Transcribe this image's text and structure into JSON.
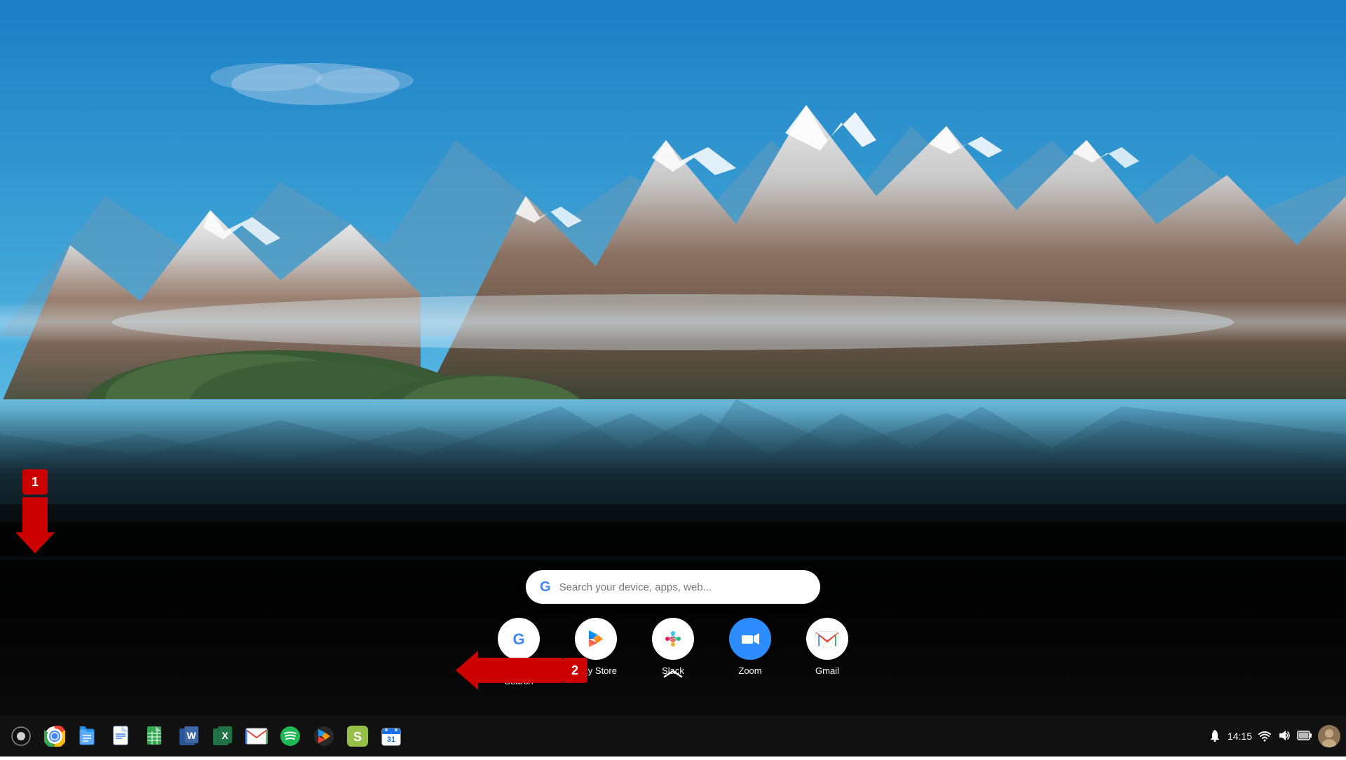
{
  "wallpaper": {
    "description": "Mountain lake landscape with snow-capped peaks"
  },
  "search": {
    "placeholder": "Search your device, apps, web...",
    "g_logo": "G"
  },
  "launcher": {
    "apps": [
      {
        "id": "google-search",
        "label": "Google Search",
        "type": "google"
      },
      {
        "id": "play-store",
        "label": "Play Store",
        "type": "playstore"
      },
      {
        "id": "slack",
        "label": "Slack",
        "type": "slack"
      },
      {
        "id": "zoom",
        "label": "Zoom",
        "type": "zoom"
      },
      {
        "id": "gmail",
        "label": "Gmail",
        "type": "gmail"
      }
    ],
    "chevron_up": "^"
  },
  "taskbar": {
    "icons": [
      {
        "id": "search",
        "label": "Search",
        "symbol": "○"
      },
      {
        "id": "chrome",
        "label": "Chrome",
        "symbol": "⊕"
      },
      {
        "id": "files",
        "label": "Files",
        "symbol": "📁"
      },
      {
        "id": "docs",
        "label": "Google Docs",
        "symbol": "📄"
      },
      {
        "id": "sheets",
        "label": "Google Sheets",
        "symbol": "📊"
      },
      {
        "id": "word",
        "label": "Microsoft Word",
        "symbol": "W"
      },
      {
        "id": "excel",
        "label": "Microsoft Excel",
        "symbol": "X"
      },
      {
        "id": "gmail",
        "label": "Gmail",
        "symbol": "M"
      },
      {
        "id": "spotify",
        "label": "Spotify",
        "symbol": "♫"
      },
      {
        "id": "play",
        "label": "Play Store",
        "symbol": "▶"
      },
      {
        "id": "shopify",
        "label": "Shopify",
        "symbol": "S"
      },
      {
        "id": "calendar",
        "label": "Calendar",
        "symbol": "31"
      }
    ],
    "time": "14:15",
    "system_icons": [
      "notification",
      "network",
      "volume",
      "battery"
    ]
  },
  "annotations": {
    "arrow1": {
      "number": "1",
      "direction": "down"
    },
    "arrow2": {
      "number": "2",
      "direction": "left"
    }
  }
}
